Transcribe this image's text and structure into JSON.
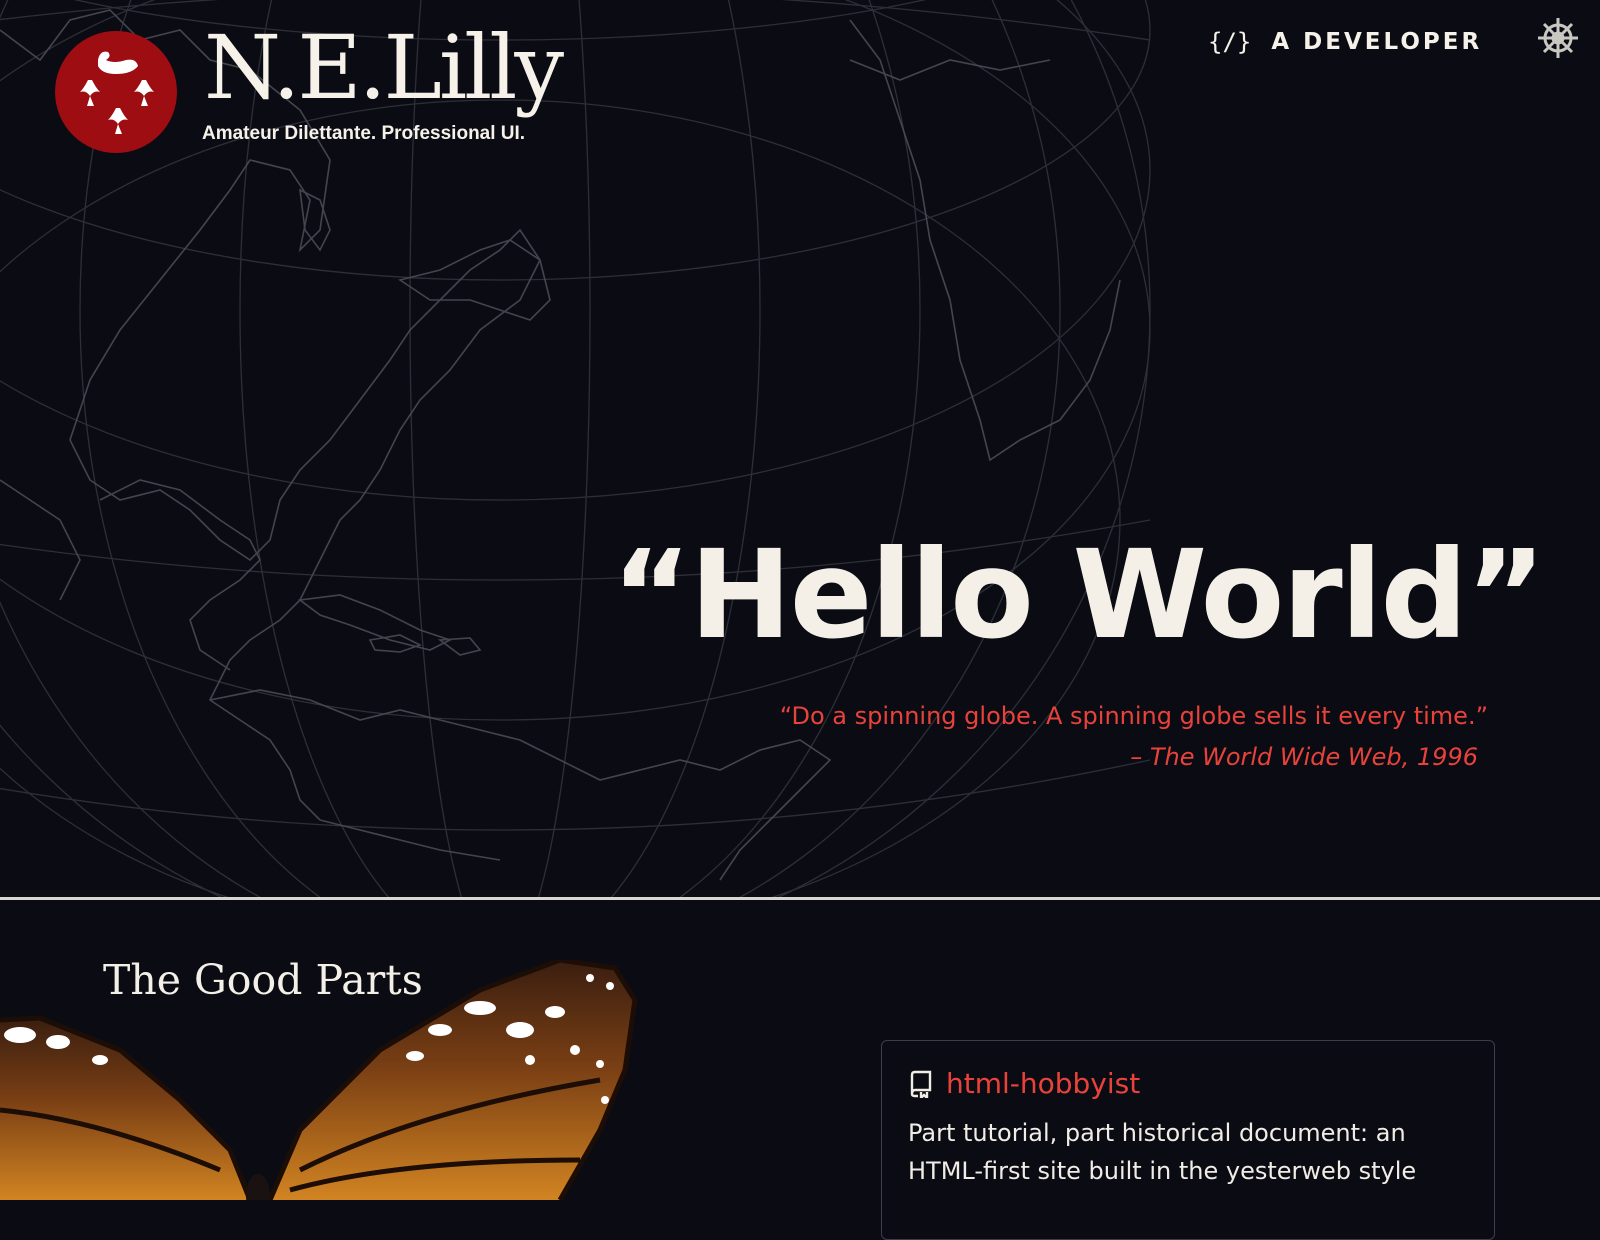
{
  "site": {
    "name": "N.E.Lilly",
    "tagline": "Amateur Dilettante. Professional UI.",
    "logo_icon": "swan-and-lilies-crest-icon",
    "brand_color": "#9e0d12"
  },
  "nav": {
    "code_icon": "{/}",
    "developer_label": "A DEVELOPER",
    "settings_icon": "ship-wheel-icon"
  },
  "hero": {
    "title": "“Hello World”",
    "quote": "“Do a spinning globe. A spinning globe sells it every time.”",
    "attribution": "– The World Wide Web, 1996"
  },
  "section": {
    "title": "The Good Parts",
    "image": "monarch-butterfly"
  },
  "card": {
    "icon": "repo-book-icon",
    "title": "html-hobbyist",
    "description": "Part tutorial, part historical document: an HTML-first site built in the yesterweb style"
  },
  "colors": {
    "background": "#0b0c13",
    "accent_red": "#e8423a",
    "text": "#f4f0e8"
  }
}
